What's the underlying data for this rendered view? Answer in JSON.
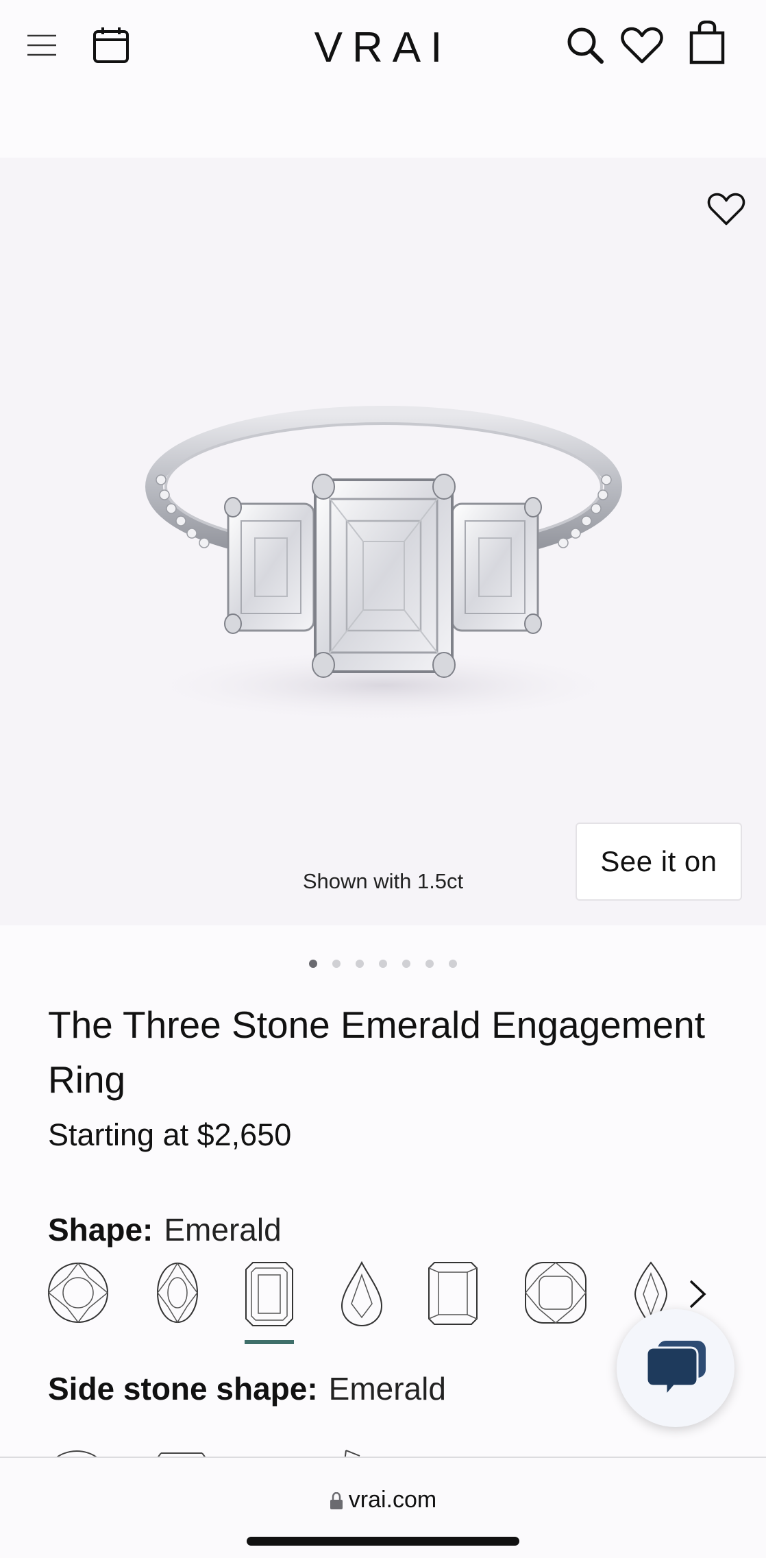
{
  "header": {
    "brand": "VRAI",
    "icons": [
      "menu-icon",
      "calendar-icon",
      "search-icon",
      "heart-icon",
      "shopping-bag-icon"
    ]
  },
  "hero": {
    "caption": "Shown with 1.5ct",
    "see_it_on_label": "See it on",
    "image_description_icon": "ring-image",
    "carousel": {
      "count": 7,
      "active_index": 0
    }
  },
  "product": {
    "title": "The Three Stone Emerald Engagement Ring",
    "price": "Starting at $2,650"
  },
  "shape": {
    "label": "Shape:",
    "value": "Emerald",
    "options": [
      "round",
      "oval",
      "emerald",
      "pear",
      "radiant",
      "cushion",
      "marquise"
    ],
    "selected": "emerald"
  },
  "side_stone": {
    "label": "Side stone shape:",
    "value": "Emerald"
  },
  "browser": {
    "url": "vrai.com"
  },
  "colors": {
    "accent": "#3f6f6a",
    "chat": "#1e3a5c",
    "hero_bg": "#f6f4f8"
  }
}
